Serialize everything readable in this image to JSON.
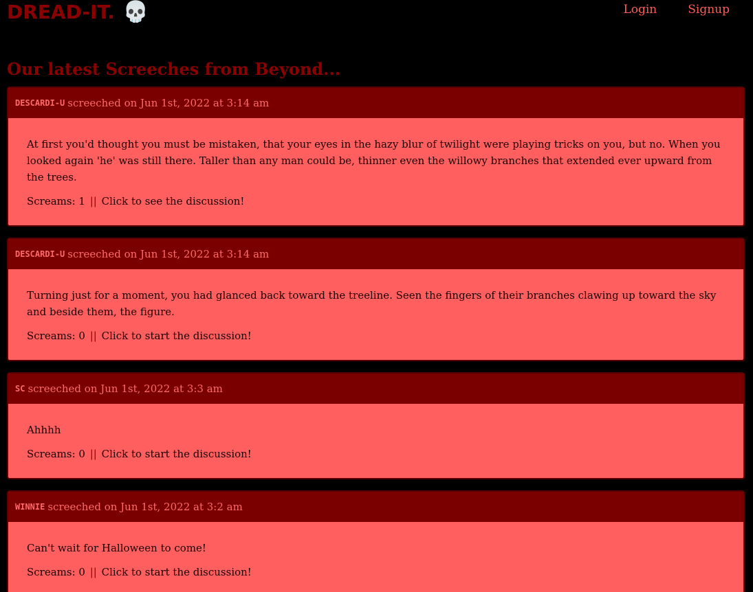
{
  "header": {
    "brand": "DREAD-IT.",
    "brand_icon": "skull-icon",
    "brand_icon_glyph": "💀",
    "nav": {
      "login": "Login",
      "signup": "Signup"
    }
  },
  "page_title": "Our latest Screeches from Beyond...",
  "colors": {
    "background": "#000000",
    "card_header": "#7a0000",
    "card_body": "#ff5f5f",
    "accent": "#8b0000",
    "link": "#ff5a5a"
  },
  "posts": [
    {
      "author": "descardi-u",
      "action": "screeched on Jun 1st, 2022 at 3:14 am",
      "text": "At first you'd thought you must be mistaken, that your eyes in the hazy blur of twilight were playing tricks on you, but no. When you looked again 'he' was still there. Taller than any man could be, thinner even the willowy branches that extended ever upward from the trees.",
      "screams_label": "Screams: 1",
      "separator": "||",
      "discussion_link": "Click to see the discussion!"
    },
    {
      "author": "descardi-u",
      "action": "screeched on Jun 1st, 2022 at 3:14 am",
      "text": "Turning just for a moment, you had glanced back toward the treeline. Seen the fingers of their branches clawing up toward the sky and beside them, the figure.",
      "screams_label": "Screams: 0",
      "separator": "||",
      "discussion_link": "Click to start the discussion!"
    },
    {
      "author": "sc",
      "action": "screeched on Jun 1st, 2022 at 3:3 am",
      "text": "Ahhhh",
      "screams_label": "Screams: 0",
      "separator": "||",
      "discussion_link": "Click to start the discussion!"
    },
    {
      "author": "winnie",
      "action": "screeched on Jun 1st, 2022 at 3:2 am",
      "text": "Can't wait for Halloween to come!",
      "screams_label": "Screams: 0",
      "separator": "||",
      "discussion_link": "Click to start the discussion!"
    }
  ]
}
